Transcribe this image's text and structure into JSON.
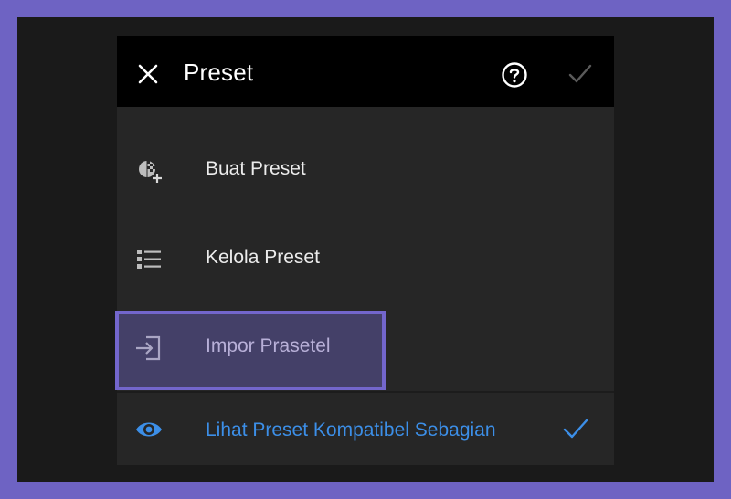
{
  "header": {
    "title": "Preset",
    "close_icon": "close-icon",
    "help_icon": "help-circle-icon",
    "done_icon": "checkmark-icon"
  },
  "menu": {
    "items": [
      {
        "label": "Buat Preset",
        "icon": "create-preset-icon"
      },
      {
        "label": "Kelola Preset",
        "icon": "list-icon"
      },
      {
        "label": "Impor Prasetel",
        "icon": "import-icon",
        "highlighted": true
      },
      {
        "label": "Lihat Preset Kompatibel Sebagian",
        "icon": "eye-icon",
        "checked": true
      }
    ]
  },
  "colors": {
    "frame": "#6e63c3",
    "highlight_border": "#7366cc",
    "accent_blue": "#3c8fe8",
    "panel": "#262626",
    "header": "#000000"
  }
}
